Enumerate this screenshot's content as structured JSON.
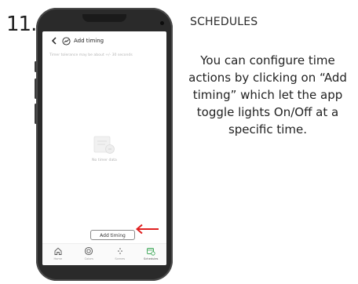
{
  "step_number": "11.",
  "section_heading": "SCHEDULES",
  "description": "You can configure time actions by clicking on “Add timing” which let the app toggle lights On/Off at a specific time.",
  "app": {
    "title": "Add timing",
    "tolerance_note": "Timer tolerance may be about +/- 30 seconds",
    "empty_state": "No timer data",
    "add_timing_button": "Add timing",
    "nav": [
      {
        "label": "Home",
        "icon": "home-icon"
      },
      {
        "label": "Colors",
        "icon": "colors-icon"
      },
      {
        "label": "Scenes",
        "icon": "scenes-icon"
      },
      {
        "label": "Schedules",
        "icon": "schedules-icon",
        "active": true
      }
    ]
  },
  "colors": {
    "annotation_arrow": "#e02020",
    "active_nav": "#3aa655",
    "phone_frame": "#2a2a2a"
  }
}
